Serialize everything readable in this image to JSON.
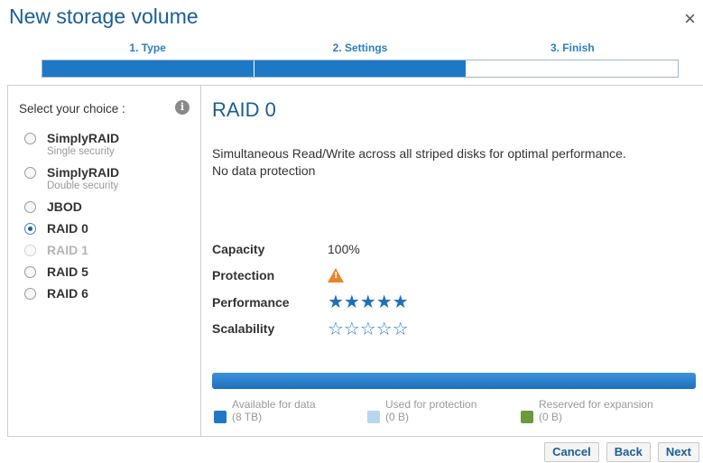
{
  "dialog": {
    "title": "New storage volume",
    "close_glyph": "×"
  },
  "steps": [
    {
      "label": "1. Type",
      "state": "done"
    },
    {
      "label": "2. Settings",
      "state": "done"
    },
    {
      "label": "3. Finish",
      "state": "todo"
    }
  ],
  "colors": {
    "accent": "#1f78c6",
    "title": "#1a5e96",
    "warning": "#e8852c",
    "protection": "#b8d6ee",
    "expansion": "#6a9a3c"
  },
  "choices": {
    "label": "Select your choice :",
    "info_icon": "i",
    "options": [
      {
        "name": "SimplyRAID",
        "sub": "Single security",
        "checked": false,
        "disabled": false
      },
      {
        "name": "SimplyRAID",
        "sub": "Double security",
        "checked": false,
        "disabled": false
      },
      {
        "name": "JBOD",
        "sub": "",
        "checked": false,
        "disabled": false
      },
      {
        "name": "RAID 0",
        "sub": "",
        "checked": true,
        "disabled": false
      },
      {
        "name": "RAID 1",
        "sub": "",
        "checked": false,
        "disabled": true
      },
      {
        "name": "RAID 5",
        "sub": "",
        "checked": false,
        "disabled": false
      },
      {
        "name": "RAID 6",
        "sub": "",
        "checked": false,
        "disabled": false
      }
    ]
  },
  "detail": {
    "title": "RAID 0",
    "description_line1": "Simultaneous Read/Write across all striped disks for optimal performance.",
    "description_line2": "No data protection",
    "capacity_label": "Capacity",
    "capacity_value": "100%",
    "protection_label": "Protection",
    "protection_icon": "warning-triangle",
    "performance_label": "Performance",
    "performance_stars": "★★★★★",
    "performance_rating": 5,
    "scalability_label": "Scalability",
    "scalability_stars": "☆☆☆☆☆",
    "scalability_rating": 0
  },
  "storage_bar": {
    "available_fraction": 1.0
  },
  "legend": {
    "available_label": "Available for data",
    "available_value": "(8 TB)",
    "protection_label": "Used for protection",
    "protection_value": "(0 B)",
    "expansion_label": "Reserved for expansion",
    "expansion_value": "(0 B)"
  },
  "buttons": {
    "cancel": "Cancel",
    "back": "Back",
    "next": "Next"
  }
}
